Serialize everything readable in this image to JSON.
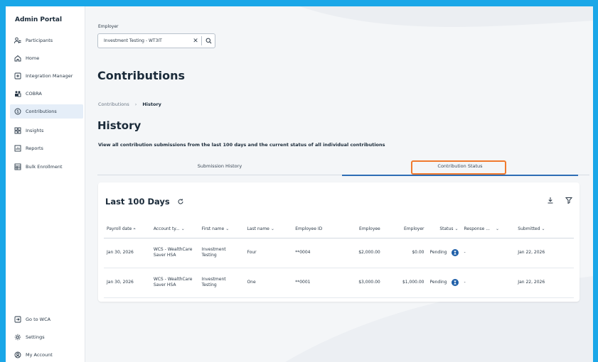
{
  "sidebar": {
    "title": "Admin Portal",
    "items": [
      {
        "label": "Participants",
        "icon": "users-icon"
      },
      {
        "label": "Home",
        "icon": "home-icon"
      },
      {
        "label": "Integration Manager",
        "icon": "plus-square-icon"
      },
      {
        "label": "COBRA",
        "icon": "people-group-icon"
      },
      {
        "label": "Contributions",
        "icon": "dollar-circle-icon",
        "active": true
      },
      {
        "label": "Insights",
        "icon": "grid-icon"
      },
      {
        "label": "Reports",
        "icon": "report-icon"
      },
      {
        "label": "Bulk Enrollment",
        "icon": "table-icon"
      }
    ],
    "bottom_items": [
      {
        "label": "Go to WCA",
        "icon": "exit-icon"
      },
      {
        "label": "Settings",
        "icon": "gear-icon"
      },
      {
        "label": "My Account",
        "icon": "account-icon"
      }
    ]
  },
  "employer": {
    "label": "Employer",
    "value": "Investment Testing - WT3IT",
    "clear_glyph": "✕"
  },
  "page_title": "Contributions",
  "breadcrumb": {
    "parent": "Contributions",
    "separator": "›",
    "current": "History"
  },
  "section_title": "History",
  "description": "View all contribution submissions from the last 100 days and the current status of all individual contributions",
  "tabs": [
    {
      "label": "Submission History"
    },
    {
      "label": "Contribution Status",
      "active": true
    }
  ],
  "card": {
    "title": "Last 100 Days"
  },
  "table": {
    "headers": [
      "Payroll date",
      "Account ty...",
      "First name",
      "Last name",
      "Employee ID",
      "Employee",
      "Employer",
      "Status",
      "Response ...",
      "Submitted"
    ],
    "rows": [
      {
        "payroll_date": "Jan 30, 2026",
        "account_type": "WCS - WealthCare Saver HSA",
        "first_name": "Investment Testing",
        "last_name": "Four",
        "employee_id": "**0004",
        "employee": "$2,000.00",
        "employer": "$0.00",
        "status": "Pending",
        "response": "-",
        "submitted": "Jan 22, 2026"
      },
      {
        "payroll_date": "Jan 30, 2026",
        "account_type": "WCS - WealthCare Saver HSA",
        "first_name": "Investment Testing",
        "last_name": "One",
        "employee_id": "**0001",
        "employee": "$3,000.00",
        "employer": "$1,000.00",
        "status": "Pending",
        "response": "-",
        "submitted": "Jan 22, 2026"
      }
    ]
  },
  "colors": {
    "accent": "#2d6db5",
    "highlight": "#f07a2e",
    "frame": "#1aa7e8",
    "status_icon": "#1f5fa8"
  }
}
